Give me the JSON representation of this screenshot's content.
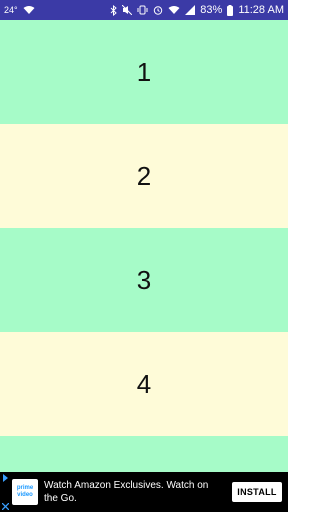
{
  "status_bar": {
    "temp": "24°",
    "battery_percent": "83%",
    "time": "11:28 AM",
    "bg_color": "#3b3aa6"
  },
  "rows": [
    {
      "label": "1",
      "color": "#a6fbc8"
    },
    {
      "label": "2",
      "color": "#fefbd8"
    },
    {
      "label": "3",
      "color": "#a6fbc8"
    },
    {
      "label": "4",
      "color": "#fefbd8"
    },
    {
      "label": "",
      "color": "#a6fbc8"
    }
  ],
  "ad": {
    "logo_line1": "prime",
    "logo_line2": "video",
    "text": "Watch Amazon Exclusives. Watch on the Go.",
    "install_label": "INSTALL"
  }
}
